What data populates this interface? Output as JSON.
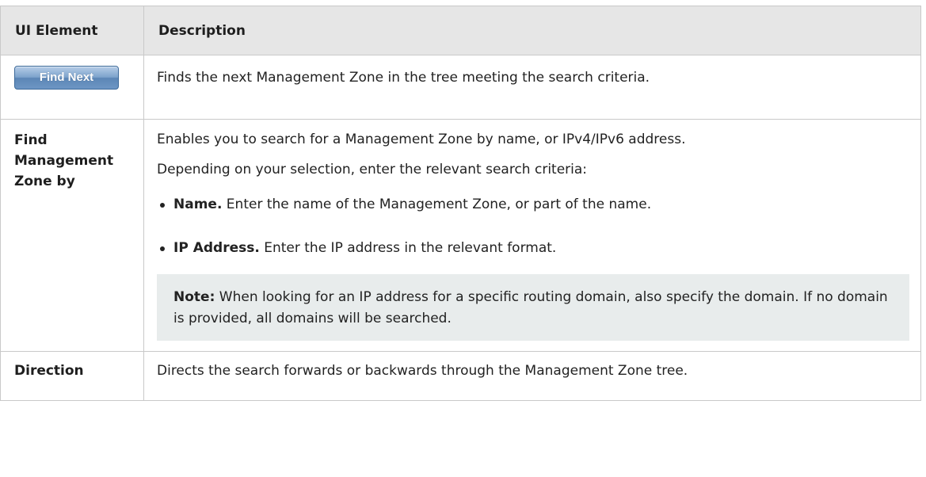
{
  "table": {
    "headers": {
      "element": "UI Element",
      "description": "Description"
    },
    "rows": [
      {
        "button_label": "Find Next",
        "description": "Finds the next Management Zone in the tree meeting the search criteria."
      },
      {
        "element_lines": [
          "Find",
          "Management",
          "Zone by"
        ],
        "description_intro": "Enables you to search for a Management Zone by name, or IPv4/IPv6 address.",
        "description_detail": "Depending on your selection, enter the relevant search criteria:",
        "bullets": [
          {
            "term": "Name.",
            "text": " Enter the name of the Management Zone, or part of the name."
          },
          {
            "term": "IP Address.",
            "text": " Enter the IP address in the relevant format."
          }
        ],
        "note": {
          "label": "Note:",
          "text": " When looking for an IP address for a specific routing domain, also specify the domain. If no domain is provided, all domains will be searched."
        }
      },
      {
        "element": "Direction",
        "description": "Directs the search forwards or backwards through the Management Zone tree."
      }
    ]
  }
}
